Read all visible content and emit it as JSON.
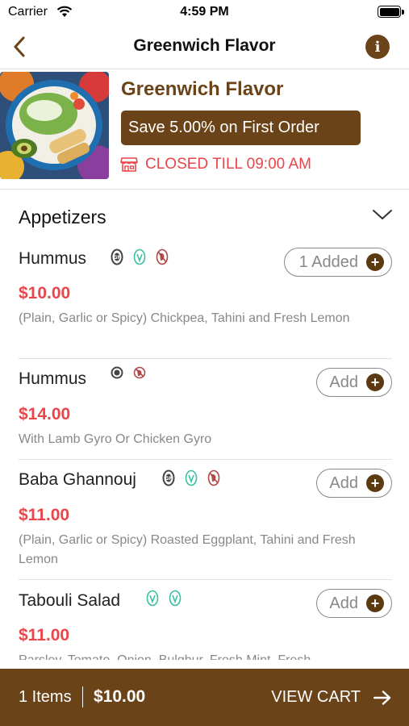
{
  "status_bar": {
    "carrier": "Carrier",
    "time": "4:59 PM"
  },
  "nav": {
    "title": "Greenwich Flavor",
    "back_icon": "chevron-left-icon",
    "info_icon": "info-icon"
  },
  "restaurant": {
    "name": "Greenwich Flavor",
    "promo": "Save 5.00% on First Order",
    "status": "CLOSED TILL 09:00 AM"
  },
  "section": {
    "title": "Appetizers"
  },
  "menu_items": [
    {
      "name": "Hummus",
      "price": "$10.00",
      "description": "(Plain, Garlic or Spicy) Chickpea, Tahini and Fresh Lemon",
      "button_label": "1 Added",
      "icons": [
        "gluten-free-icon",
        "vegan-icon",
        "no-meat-icon"
      ]
    },
    {
      "name": "Hummus",
      "price": "$14.00",
      "description": "With Lamb Gyro Or Chicken Gyro",
      "button_label": "Add",
      "icons": [
        "gluten-free-icon",
        "no-meat-icon"
      ]
    },
    {
      "name": "Baba Ghannouj",
      "price": "$11.00",
      "description": "(Plain, Garlic or Spicy) Roasted Eggplant, Tahini and Fresh Lemon",
      "button_label": "Add",
      "icons": [
        "gluten-free-icon",
        "vegan-icon",
        "no-meat-icon"
      ]
    },
    {
      "name": "Tabouli Salad",
      "price": "$11.00",
      "description": "Parsley, Tomato, Onion, Bulghur, Fresh Mint, Fresh",
      "button_label": "Add",
      "icons": [
        "vegan-icon",
        "vegan-icon"
      ]
    }
  ],
  "cart": {
    "count": "1 Items",
    "total": "$10.00",
    "action": "VIEW CART"
  },
  "colors": {
    "brand": "#6b4318",
    "price": "#e8464a",
    "vegan": "#3bbfa3"
  }
}
